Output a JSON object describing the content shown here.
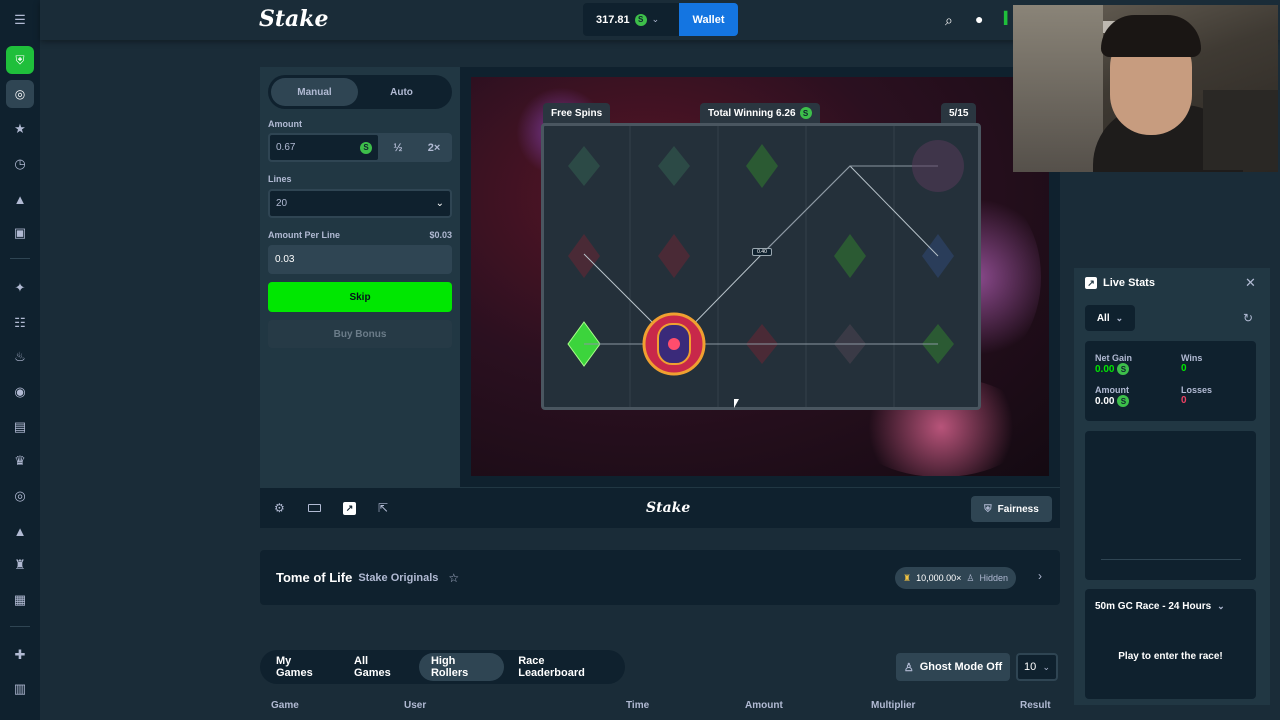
{
  "header": {
    "logo": "Stake",
    "balance": "317.81",
    "currency_symbol": "S",
    "wallet_label": "Wallet"
  },
  "controls": {
    "tabs": [
      "Manual",
      "Auto"
    ],
    "amount_label": "Amount",
    "amount_value": "0.67",
    "half_label": "½",
    "double_label": "2×",
    "lines_label": "Lines",
    "lines_value": "20",
    "amount_per_line_label": "Amount Per Line",
    "amount_per_line_usd": "$0.03",
    "amount_per_line_value": "0.03",
    "skip_label": "Skip",
    "buy_bonus_label": "Buy Bonus"
  },
  "game": {
    "free_spins_label": "Free Spins",
    "total_winning_label": "Total Winning 6.26",
    "spins_counter": "5/15",
    "line_badge": "0.40"
  },
  "toolbar": {
    "brand": "Stake",
    "fairness_label": "Fairness"
  },
  "game_info": {
    "title": "Tome of Life",
    "provider": "Stake Originals",
    "max_multiplier": "10,000.00×",
    "hidden_label": "Hidden"
  },
  "bets": {
    "tabs": [
      "My Games",
      "All Games",
      "High Rollers",
      "Race Leaderboard"
    ],
    "active_tab": "High Rollers",
    "ghost_mode_label": "Ghost Mode Off",
    "rows_count": "10",
    "columns": [
      "Game",
      "User",
      "Time",
      "Amount",
      "Multiplier",
      "Result"
    ]
  },
  "live_stats": {
    "title": "Live Stats",
    "filter": "All",
    "net_gain_label": "Net Gain",
    "net_gain_value": "0.00",
    "wins_label": "Wins",
    "wins_value": "0",
    "amount_label": "Amount",
    "amount_value": "0.00",
    "losses_label": "Losses",
    "losses_value": "0",
    "race_title": "50m GC Race - 24 Hours",
    "race_message": "Play to enter the race!"
  },
  "colors": {
    "accent_green": "#00e701",
    "wallet_blue": "#1475e1",
    "coin_green": "#3dbf4a",
    "loss_pink": "#ed4163"
  }
}
